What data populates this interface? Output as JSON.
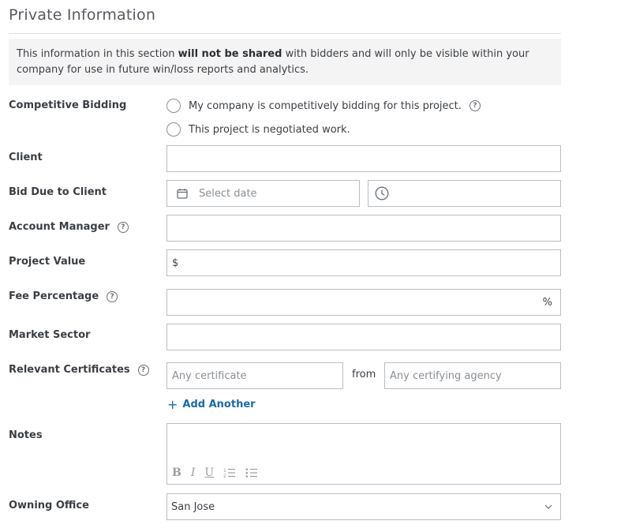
{
  "section": {
    "title": "Private Information",
    "notice_pre": "This information in this section ",
    "notice_bold": "will not be shared",
    "notice_post": " with bidders and will only be visible within your company for use in future win/loss reports and analytics."
  },
  "competitive_bidding": {
    "label": "Competitive Bidding",
    "option_1": "My company is competitively bidding for this project.",
    "option_2": "This project is negotiated work.",
    "help_glyph": "?"
  },
  "client": {
    "label": "Client",
    "value": ""
  },
  "bid_due": {
    "label": "Bid Due to Client",
    "date_placeholder": "Select date",
    "date_icon": "calendar-icon",
    "time_icon": "clock-icon"
  },
  "account_manager": {
    "label": "Account Manager",
    "help_glyph": "?"
  },
  "project_value": {
    "label": "Project Value",
    "prefix": "$"
  },
  "fee_percentage": {
    "label": "Fee Percentage",
    "suffix": "%",
    "help_glyph": "?"
  },
  "market_sector": {
    "label": "Market Sector"
  },
  "certificates": {
    "label": "Relevant Certificates",
    "help_glyph": "?",
    "certificate_placeholder": "Any certificate",
    "from_text": "from",
    "agency_placeholder": "Any certifying agency",
    "add_another": "Add Another",
    "add_icon": "+"
  },
  "notes": {
    "label": "Notes",
    "toolbar": {
      "bold": "B",
      "italic": "I",
      "underline": "U"
    }
  },
  "owning_office": {
    "label": "Owning Office",
    "value": "San Jose"
  },
  "colors": {
    "link": "#1a6aa8",
    "border": "#b9bdc2",
    "notice_bg": "#f4f4f5"
  }
}
